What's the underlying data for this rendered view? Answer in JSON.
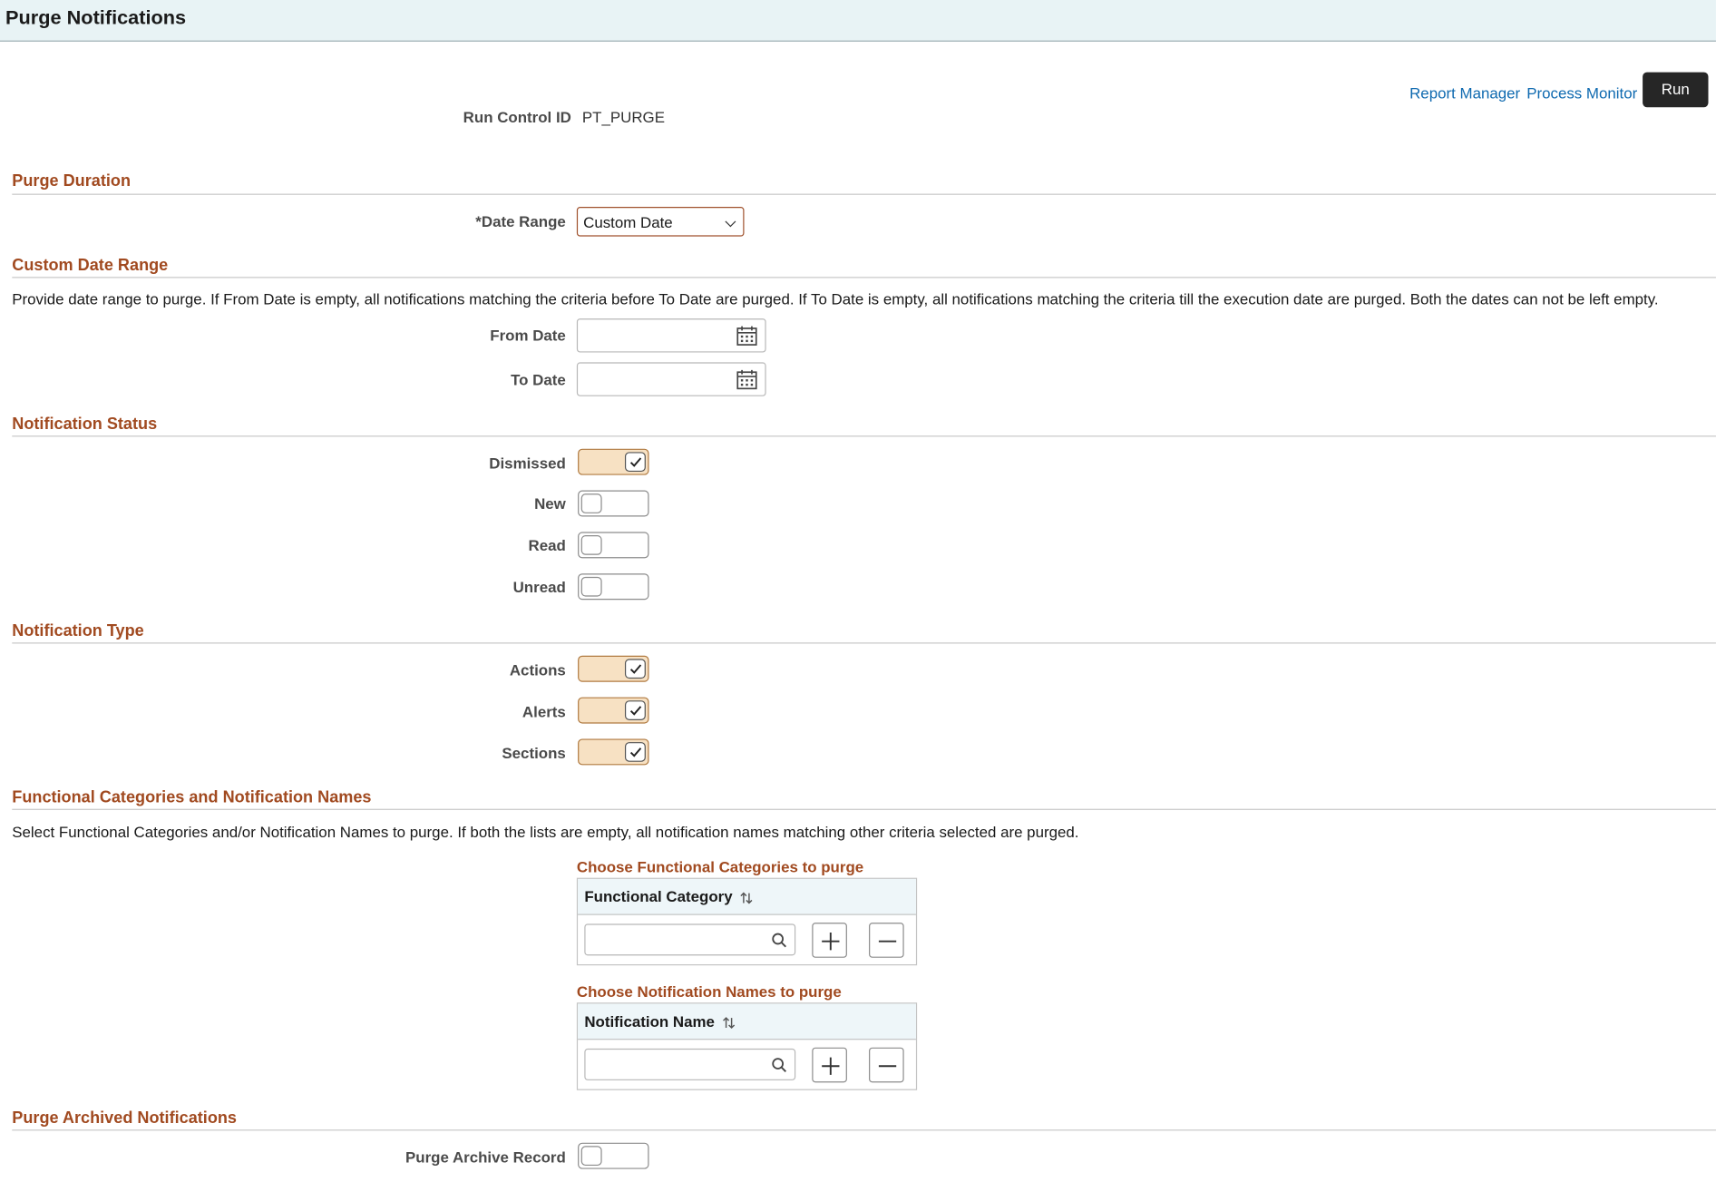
{
  "header": {
    "title": "Purge Notifications"
  },
  "toolbar": {
    "report_manager": "Report Manager",
    "process_monitor": "Process Monitor",
    "run_label": "Run"
  },
  "run_control": {
    "label": "Run Control ID",
    "value": "PT_PURGE"
  },
  "purge_duration": {
    "title": "Purge Duration",
    "date_range_label": "*Date Range",
    "date_range_value": "Custom Date"
  },
  "custom_date_range": {
    "title": "Custom Date Range",
    "description": "Provide date range to purge. If From Date is empty, all notifications matching the criteria before To Date are purged. If To Date is empty, all notifications matching the criteria till the execution date are purged. Both the dates can not be left empty.",
    "from_label": "From Date",
    "from_value": "",
    "to_label": "To Date",
    "to_value": ""
  },
  "notification_status": {
    "title": "Notification Status",
    "items": [
      {
        "label": "Dismissed",
        "checked": true
      },
      {
        "label": "New",
        "checked": false
      },
      {
        "label": "Read",
        "checked": false
      },
      {
        "label": "Unread",
        "checked": false
      }
    ]
  },
  "notification_type": {
    "title": "Notification Type",
    "items": [
      {
        "label": "Actions",
        "checked": true
      },
      {
        "label": "Alerts",
        "checked": true
      },
      {
        "label": "Sections",
        "checked": true
      }
    ]
  },
  "functional": {
    "title": "Functional Categories and Notification Names",
    "description": "Select Functional Categories and/or Notification Names to purge. If both the lists are empty, all notification names matching other criteria selected are purged.",
    "categories_grid": {
      "title": "Choose Functional Categories to purge",
      "column": "Functional Category",
      "value": ""
    },
    "names_grid": {
      "title": "Choose Notification Names to purge",
      "column": "Notification Name",
      "value": ""
    }
  },
  "purge_archived": {
    "title": "Purge Archived Notifications",
    "label": "Purge Archive Record",
    "checked": false
  },
  "colors": {
    "section_title": "#a14a20",
    "link": "#0f6ab0",
    "toggle_on": "#f7e1c3",
    "header_bg": "#e8f3f5",
    "run_button": "#262626"
  },
  "icons": {
    "calendar": "calendar-icon",
    "search": "search-icon",
    "plus": "plus-icon",
    "minus": "minus-icon",
    "sort": "sort-icon",
    "check": "check-icon",
    "chevron": "chevron-down-icon"
  }
}
